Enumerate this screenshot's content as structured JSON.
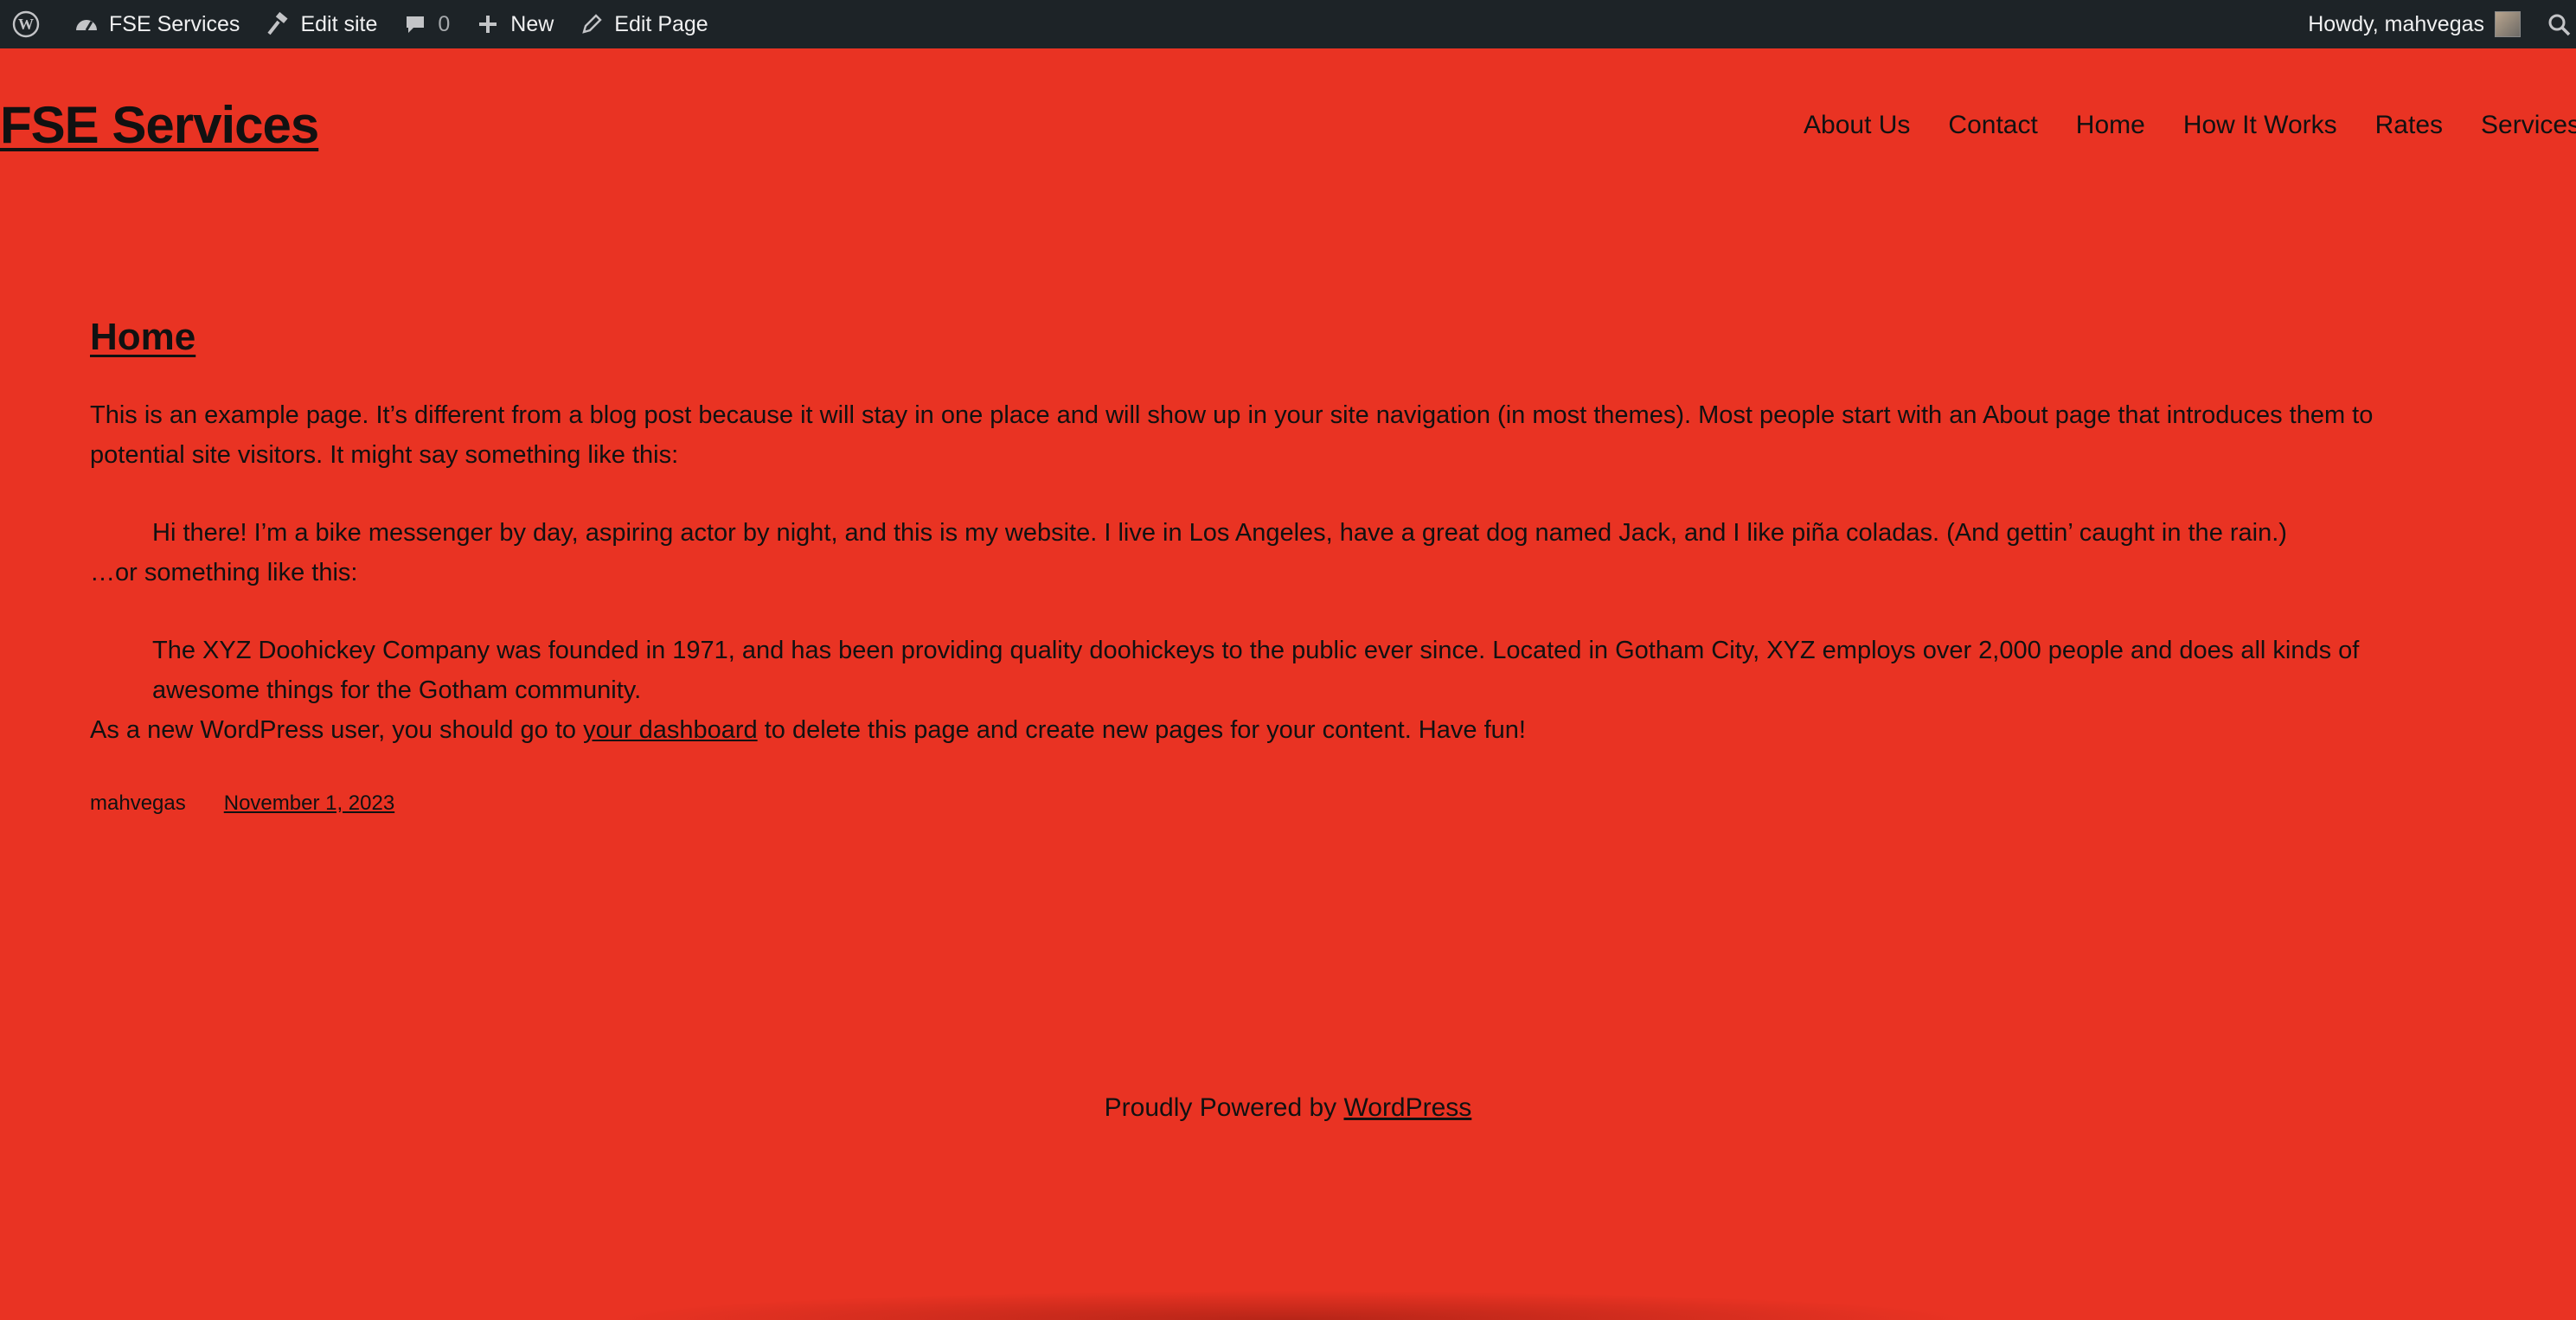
{
  "admin_bar": {
    "site_name": "FSE Services",
    "edit_site": "Edit site",
    "comments_count": "0",
    "new": "New",
    "edit_page": "Edit Page",
    "howdy": "Howdy, mahvegas"
  },
  "header": {
    "site_title": "FSE Services",
    "nav": [
      "About Us",
      "Contact",
      "Home",
      "How It Works",
      "Rates",
      "Services"
    ]
  },
  "page": {
    "title": "Home",
    "intro_line1": "This is an example page. It’s different from a blog post because it will stay in one place and will show up in your site navigation (in most themes). Most people start with an About page that introduces them to",
    "intro_line2": "potential site visitors. It might say something like this:",
    "quote1": "Hi there! I’m a bike messenger by day, aspiring actor by night, and this is my website. I live in Los Angeles, have a great dog named Jack, and I like piña coladas. (And gettin’ caught in the rain.)",
    "or_line": "…or something like this:",
    "quote2_line1": "The XYZ Doohickey Company was founded in 1971, and has been providing quality doohickeys to the public ever since. Located in Gotham City, XYZ employs over 2,000 people and does all kinds of",
    "quote2_line2": "awesome things for the Gotham community.",
    "outro_before": "As a new WordPress user, you should go to ",
    "outro_link": "your dashboard",
    "outro_after": " to delete this page and create new pages for your content. Have fun!",
    "author": "mahvegas",
    "date": "November 1, 2023"
  },
  "footer": {
    "text": "Proudly Powered by ",
    "link": "WordPress"
  }
}
